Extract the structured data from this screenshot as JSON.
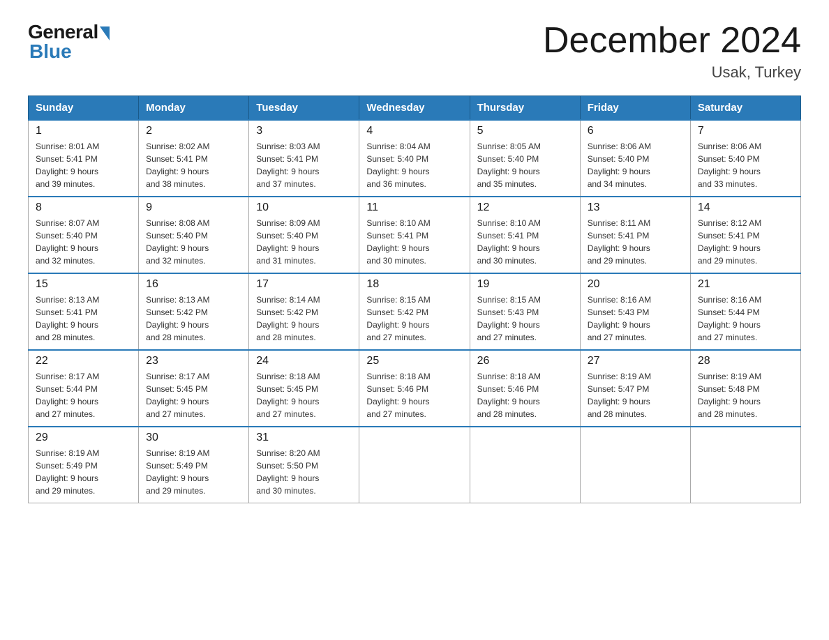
{
  "logo": {
    "general": "General",
    "blue": "Blue"
  },
  "title": "December 2024",
  "location": "Usak, Turkey",
  "days_of_week": [
    "Sunday",
    "Monday",
    "Tuesday",
    "Wednesday",
    "Thursday",
    "Friday",
    "Saturday"
  ],
  "weeks": [
    [
      {
        "day": "1",
        "sunrise": "8:01 AM",
        "sunset": "5:41 PM",
        "daylight": "9 hours and 39 minutes."
      },
      {
        "day": "2",
        "sunrise": "8:02 AM",
        "sunset": "5:41 PM",
        "daylight": "9 hours and 38 minutes."
      },
      {
        "day": "3",
        "sunrise": "8:03 AM",
        "sunset": "5:41 PM",
        "daylight": "9 hours and 37 minutes."
      },
      {
        "day": "4",
        "sunrise": "8:04 AM",
        "sunset": "5:40 PM",
        "daylight": "9 hours and 36 minutes."
      },
      {
        "day": "5",
        "sunrise": "8:05 AM",
        "sunset": "5:40 PM",
        "daylight": "9 hours and 35 minutes."
      },
      {
        "day": "6",
        "sunrise": "8:06 AM",
        "sunset": "5:40 PM",
        "daylight": "9 hours and 34 minutes."
      },
      {
        "day": "7",
        "sunrise": "8:06 AM",
        "sunset": "5:40 PM",
        "daylight": "9 hours and 33 minutes."
      }
    ],
    [
      {
        "day": "8",
        "sunrise": "8:07 AM",
        "sunset": "5:40 PM",
        "daylight": "9 hours and 32 minutes."
      },
      {
        "day": "9",
        "sunrise": "8:08 AM",
        "sunset": "5:40 PM",
        "daylight": "9 hours and 32 minutes."
      },
      {
        "day": "10",
        "sunrise": "8:09 AM",
        "sunset": "5:40 PM",
        "daylight": "9 hours and 31 minutes."
      },
      {
        "day": "11",
        "sunrise": "8:10 AM",
        "sunset": "5:41 PM",
        "daylight": "9 hours and 30 minutes."
      },
      {
        "day": "12",
        "sunrise": "8:10 AM",
        "sunset": "5:41 PM",
        "daylight": "9 hours and 30 minutes."
      },
      {
        "day": "13",
        "sunrise": "8:11 AM",
        "sunset": "5:41 PM",
        "daylight": "9 hours and 29 minutes."
      },
      {
        "day": "14",
        "sunrise": "8:12 AM",
        "sunset": "5:41 PM",
        "daylight": "9 hours and 29 minutes."
      }
    ],
    [
      {
        "day": "15",
        "sunrise": "8:13 AM",
        "sunset": "5:41 PM",
        "daylight": "9 hours and 28 minutes."
      },
      {
        "day": "16",
        "sunrise": "8:13 AM",
        "sunset": "5:42 PM",
        "daylight": "9 hours and 28 minutes."
      },
      {
        "day": "17",
        "sunrise": "8:14 AM",
        "sunset": "5:42 PM",
        "daylight": "9 hours and 28 minutes."
      },
      {
        "day": "18",
        "sunrise": "8:15 AM",
        "sunset": "5:42 PM",
        "daylight": "9 hours and 27 minutes."
      },
      {
        "day": "19",
        "sunrise": "8:15 AM",
        "sunset": "5:43 PM",
        "daylight": "9 hours and 27 minutes."
      },
      {
        "day": "20",
        "sunrise": "8:16 AM",
        "sunset": "5:43 PM",
        "daylight": "9 hours and 27 minutes."
      },
      {
        "day": "21",
        "sunrise": "8:16 AM",
        "sunset": "5:44 PM",
        "daylight": "9 hours and 27 minutes."
      }
    ],
    [
      {
        "day": "22",
        "sunrise": "8:17 AM",
        "sunset": "5:44 PM",
        "daylight": "9 hours and 27 minutes."
      },
      {
        "day": "23",
        "sunrise": "8:17 AM",
        "sunset": "5:45 PM",
        "daylight": "9 hours and 27 minutes."
      },
      {
        "day": "24",
        "sunrise": "8:18 AM",
        "sunset": "5:45 PM",
        "daylight": "9 hours and 27 minutes."
      },
      {
        "day": "25",
        "sunrise": "8:18 AM",
        "sunset": "5:46 PM",
        "daylight": "9 hours and 27 minutes."
      },
      {
        "day": "26",
        "sunrise": "8:18 AM",
        "sunset": "5:46 PM",
        "daylight": "9 hours and 28 minutes."
      },
      {
        "day": "27",
        "sunrise": "8:19 AM",
        "sunset": "5:47 PM",
        "daylight": "9 hours and 28 minutes."
      },
      {
        "day": "28",
        "sunrise": "8:19 AM",
        "sunset": "5:48 PM",
        "daylight": "9 hours and 28 minutes."
      }
    ],
    [
      {
        "day": "29",
        "sunrise": "8:19 AM",
        "sunset": "5:49 PM",
        "daylight": "9 hours and 29 minutes."
      },
      {
        "day": "30",
        "sunrise": "8:19 AM",
        "sunset": "5:49 PM",
        "daylight": "9 hours and 29 minutes."
      },
      {
        "day": "31",
        "sunrise": "8:20 AM",
        "sunset": "5:50 PM",
        "daylight": "9 hours and 30 minutes."
      },
      null,
      null,
      null,
      null
    ]
  ],
  "labels": {
    "sunrise": "Sunrise:",
    "sunset": "Sunset:",
    "daylight": "Daylight:"
  }
}
